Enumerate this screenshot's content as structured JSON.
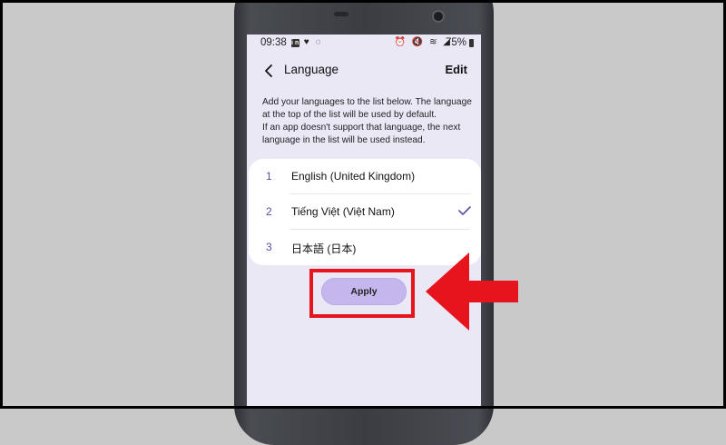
{
  "status_bar": {
    "time": "09:38",
    "left_icons": [
      "linkedin-icon",
      "heart-icon",
      "messenger-icon"
    ],
    "right_icons": [
      "alarm-icon",
      "mute-icon",
      "wifi-icon",
      "signal-icon"
    ],
    "battery": "75%"
  },
  "header": {
    "title": "Language",
    "edit_label": "Edit",
    "back_icon": "chevron-left-icon"
  },
  "description": {
    "line1": "Add your languages to the list below. The language",
    "line2": "at the top of the list will be used by default.",
    "line3": "If an app doesn't support that language, the next",
    "line4": "language in the list will be used instead."
  },
  "languages": [
    {
      "number": "1",
      "name": "English (United Kingdom)",
      "selected": false
    },
    {
      "number": "2",
      "name": "Tiếng Việt (Việt Nam)",
      "selected": true
    },
    {
      "number": "3",
      "name": "日本語 (日本)",
      "selected": false
    }
  ],
  "apply_label": "Apply",
  "colors": {
    "highlight": "#e8141d",
    "accent": "#5a4fa8",
    "button": "#c5b7ee",
    "screen_bg": "#ebe8f6"
  }
}
